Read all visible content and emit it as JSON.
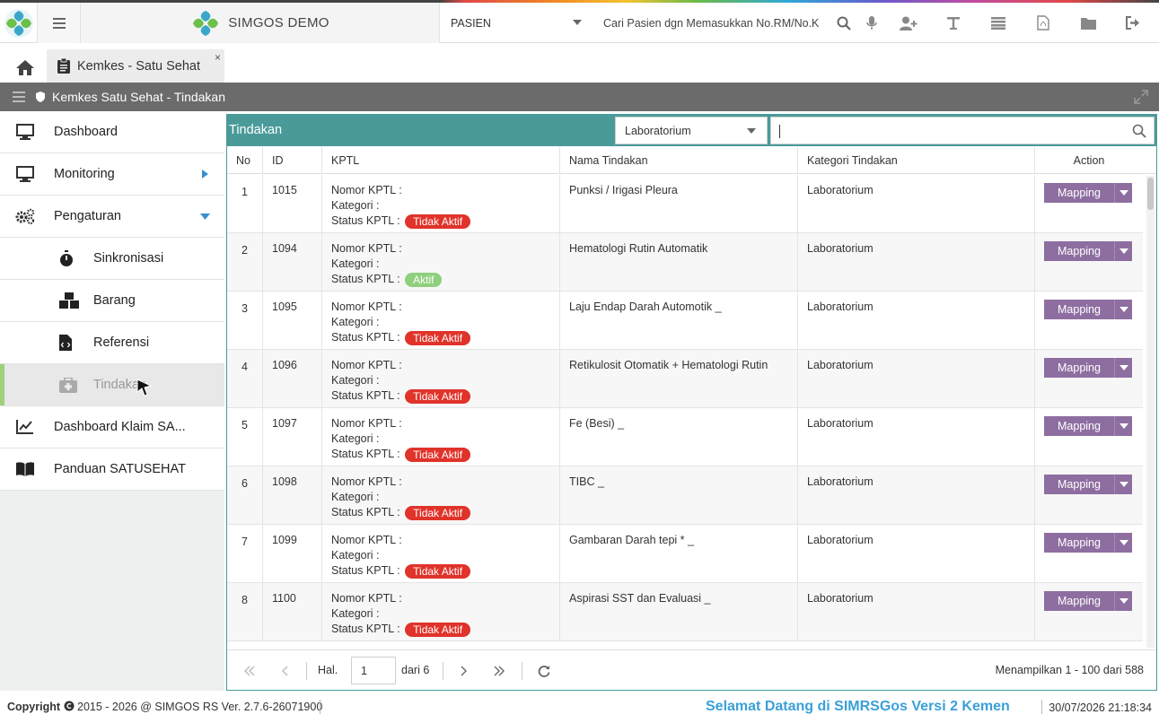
{
  "colors": {
    "teal": "#4a9a9a",
    "mapping_button": "#8e6ea0",
    "badge_inactive": "#e0332a",
    "badge_active": "#8fcf7e",
    "marquee": "#3aa0d8"
  },
  "header": {
    "brand": "SIMGOS DEMO",
    "patient_select": "PASIEN",
    "search_placeholder": "Cari Pasien dgn Memasukkan No.RM/No.K",
    "icons": [
      "search-icon",
      "microphone-icon",
      "add-user-icon",
      "text-icon",
      "list-icon",
      "pdf-icon",
      "folder-icon",
      "logout-icon"
    ]
  },
  "tabs": {
    "active_tab": "Kemkes - Satu Sehat",
    "close": "×"
  },
  "titlebar": {
    "title": "Kemkes Satu Sehat - Tindakan"
  },
  "sidebar": {
    "items": [
      {
        "label": "Dashboard",
        "icon": "monitor-icon"
      },
      {
        "label": "Monitoring",
        "icon": "monitor-icon"
      },
      {
        "label": "Pengaturan",
        "icon": "gears-icon"
      },
      {
        "label": "Sinkronisasi",
        "icon": "stopwatch-icon"
      },
      {
        "label": "Barang",
        "icon": "boxes-icon"
      },
      {
        "label": "Referensi",
        "icon": "code-file-icon"
      },
      {
        "label": "Tindakan",
        "icon": "medkit-icon"
      },
      {
        "label": "Dashboard Klaim SA...",
        "icon": "chart-line-icon"
      },
      {
        "label": "Panduan SATUSEHAT",
        "icon": "book-icon"
      }
    ]
  },
  "panel": {
    "title": "Tindakan",
    "category_select": "Laboratorium",
    "search_value": ""
  },
  "table": {
    "columns": [
      "No",
      "ID",
      "KPTL",
      "Nama Tindakan",
      "Kategori Tindakan",
      "Action"
    ],
    "kptl_labels": {
      "nomor": "Nomor KPTL :",
      "kategori": "Kategori :",
      "status": "Status KPTL :"
    },
    "action_label": "Mapping",
    "rows": [
      {
        "no": "1",
        "id": "1015",
        "status": "Tidak Aktif",
        "active": false,
        "nama": "Punksi / Irigasi Pleura",
        "kategori": "Laboratorium"
      },
      {
        "no": "2",
        "id": "1094",
        "status": "Aktif",
        "active": true,
        "nama": "Hematologi Rutin Automatik",
        "kategori": "Laboratorium"
      },
      {
        "no": "3",
        "id": "1095",
        "status": "Tidak Aktif",
        "active": false,
        "nama": "Laju Endap Darah Automotik _",
        "kategori": "Laboratorium"
      },
      {
        "no": "4",
        "id": "1096",
        "status": "Tidak Aktif",
        "active": false,
        "nama": "Retikulosit Otomatik + Hematologi Rutin",
        "kategori": "Laboratorium"
      },
      {
        "no": "5",
        "id": "1097",
        "status": "Tidak Aktif",
        "active": false,
        "nama": "Fe (Besi) _",
        "kategori": "Laboratorium"
      },
      {
        "no": "6",
        "id": "1098",
        "status": "Tidak Aktif",
        "active": false,
        "nama": "TIBC _",
        "kategori": "Laboratorium"
      },
      {
        "no": "7",
        "id": "1099",
        "status": "Tidak Aktif",
        "active": false,
        "nama": "Gambaran Darah tepi * _",
        "kategori": "Laboratorium"
      },
      {
        "no": "8",
        "id": "1100",
        "status": "Tidak Aktif",
        "active": false,
        "nama": "Aspirasi SST dan Evaluasi _",
        "kategori": "Laboratorium"
      }
    ]
  },
  "pager": {
    "page_label": "Hal.",
    "page_value": "1",
    "of_label": "dari 6",
    "info": "Menampilkan 1 - 100 dari 588"
  },
  "footer": {
    "copyright_bold": "Copyright",
    "copyright_text": "2015 - 2026 @ SIMGOS RS Ver. 2.7.6-26071900",
    "marquee": "Selamat Datang di SIMRSGos Versi 2 Kemen",
    "datetime": "30/07/2026 21:18:34"
  }
}
